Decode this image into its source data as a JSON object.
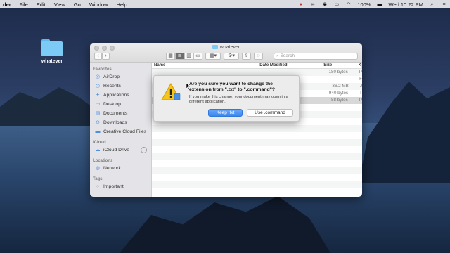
{
  "menubar": {
    "app": "der",
    "items": [
      "File",
      "Edit",
      "View",
      "Go",
      "Window",
      "Help"
    ],
    "battery": "100%",
    "clock": "Wed 10:22 PM"
  },
  "desktop": {
    "folder_label": "whatever"
  },
  "finder": {
    "title": "whatever",
    "search_placeholder": "Search",
    "sidebar": {
      "favorites_header": "Favorites",
      "favorites": [
        {
          "label": "AirDrop",
          "icon": "airdrop-icon"
        },
        {
          "label": "Recents",
          "icon": "clock-icon"
        },
        {
          "label": "Applications",
          "icon": "applications-icon"
        },
        {
          "label": "Desktop",
          "icon": "desktop-icon"
        },
        {
          "label": "Documents",
          "icon": "document-icon"
        },
        {
          "label": "Downloads",
          "icon": "downloads-icon"
        },
        {
          "label": "Creative Cloud Files",
          "icon": "folder-icon"
        }
      ],
      "icloud_header": "iCloud",
      "icloud": [
        {
          "label": "iCloud Drive",
          "icon": "cloud-icon"
        }
      ],
      "locations_header": "Locations",
      "locations": [
        {
          "label": "Network",
          "icon": "globe-icon"
        }
      ],
      "tags_header": "Tags",
      "tags": [
        {
          "label": "Important",
          "icon": "tag-icon"
        }
      ]
    },
    "columns": {
      "name": "Name",
      "date": "Date Modified",
      "size": "Size",
      "kind": "K"
    },
    "rows": [
      {
        "size": "180 bytes",
        "kind": "P"
      },
      {
        "size": "--",
        "kind": "F"
      },
      {
        "size": "36.2 MB",
        "kind": "J"
      },
      {
        "size": "940 bytes",
        "kind": "T"
      },
      {
        "size": "88 bytes",
        "kind": "P"
      }
    ]
  },
  "alert": {
    "title": "Are you sure you want to change the extension from \".txt\" to \".command\"?",
    "message": "If you make this change, your document may open in a different application.",
    "keep_label": "Keep .txt",
    "use_label": "Use .command"
  },
  "colors": {
    "accent": "#3a86f0",
    "folder": "#7ccbf7"
  }
}
